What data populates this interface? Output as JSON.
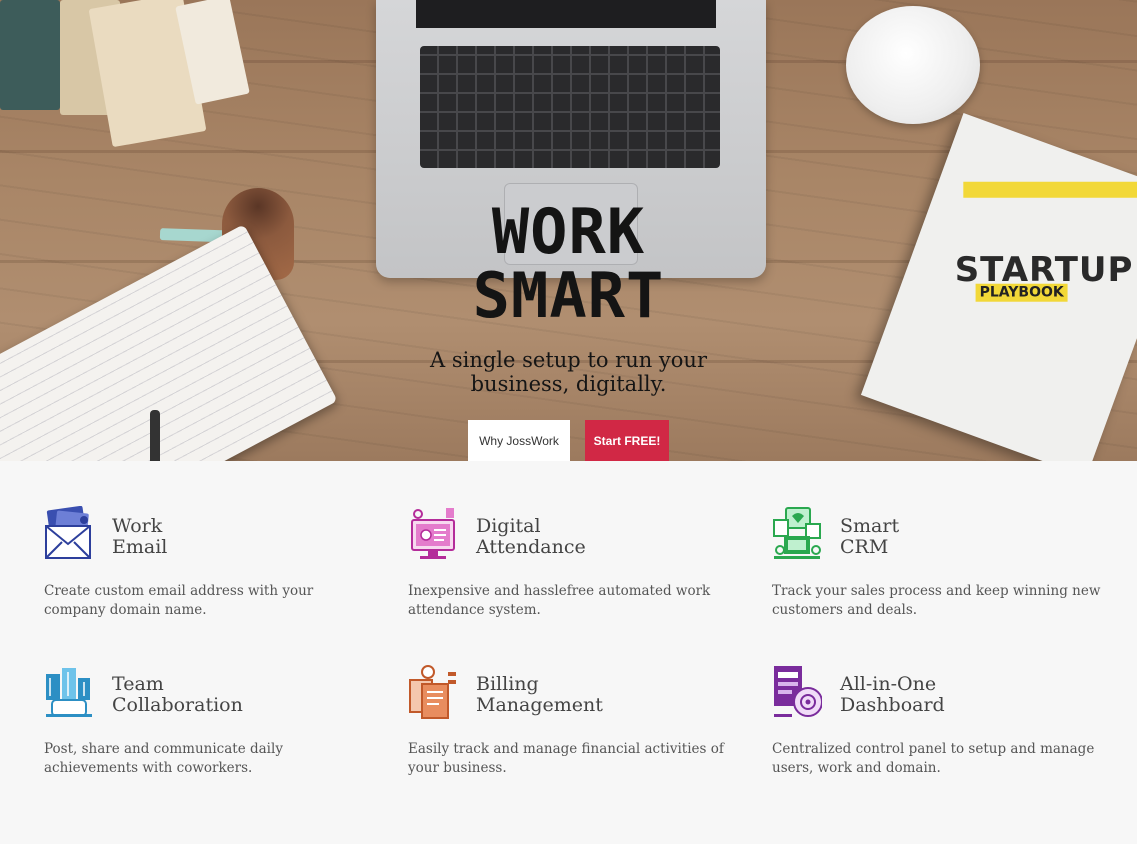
{
  "hero": {
    "title_line1": "WORK",
    "title_line2": "SMART",
    "subtitle_line1": "A single setup to run your",
    "subtitle_line2": "business, digitally.",
    "why_button": "Why JossWork",
    "start_button": "Start FREE!",
    "book_title": "STARTUP",
    "book_subtitle": "PLAYBOOK",
    "accent_color": "#d12845"
  },
  "features": [
    {
      "icon": "email-icon",
      "title_line1": "Work",
      "title_line2": "Email",
      "desc": "Create custom email address with your company domain name."
    },
    {
      "icon": "attendance-icon",
      "title_line1": "Digital",
      "title_line2": "Attendance",
      "desc": "Inexpensive and hasslefree automated work attendance system."
    },
    {
      "icon": "crm-icon",
      "title_line1": "Smart",
      "title_line2": "CRM",
      "desc": "Track your sales process and keep winning new customers and deals."
    },
    {
      "icon": "collaboration-icon",
      "title_line1": "Team",
      "title_line2": "Collaboration",
      "desc": "Post, share and communicate daily achievements with coworkers."
    },
    {
      "icon": "billing-icon",
      "title_line1": "Billing",
      "title_line2": "Management",
      "desc": "Easily track and manage financial activities of your business."
    },
    {
      "icon": "dashboard-icon",
      "title_line1": "All-in-One",
      "title_line2": "Dashboard",
      "desc": "Centralized control panel to setup and manage users, work and domain."
    }
  ]
}
